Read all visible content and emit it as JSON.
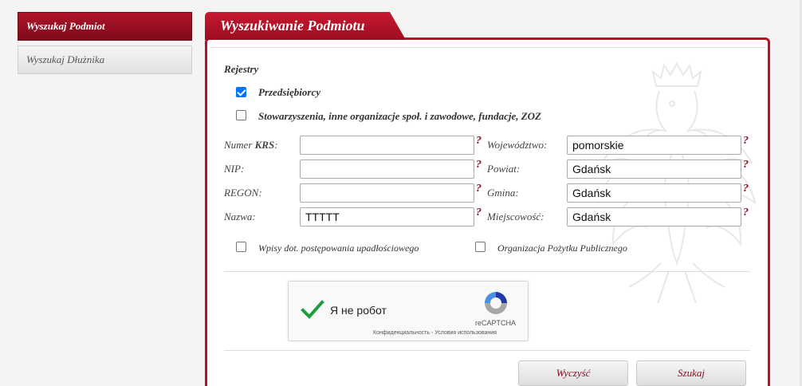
{
  "sidebar": {
    "items": [
      {
        "label": "Wyszukaj Podmiot",
        "active": true
      },
      {
        "label": "Wyszukaj Dłużnika",
        "active": false
      }
    ]
  },
  "panel": {
    "title": "Wyszukiwanie Podmiotu"
  },
  "registers": {
    "heading": "Rejestry",
    "options": [
      {
        "label": "Przedsiębiorcy",
        "checked": true
      },
      {
        "label": "Stowarzyszenia, inne organizacje społ. i zawodowe, fundacje, ZOZ",
        "checked": false
      }
    ]
  },
  "fields": {
    "krs": {
      "label_prefix": "Numer ",
      "label_bold": "KRS",
      "label_suffix": ":",
      "value": ""
    },
    "nip": {
      "label": "NIP:",
      "value": ""
    },
    "regon": {
      "label": "REGON:",
      "value": ""
    },
    "nazwa": {
      "label": "Nazwa:",
      "value": "TTTTT"
    },
    "wojewodztwo": {
      "label": "Województwo:",
      "value": "pomorskie"
    },
    "powiat": {
      "label": "Powiat:",
      "value": "Gdańsk"
    },
    "gmina": {
      "label": "Gmina:",
      "value": "Gdańsk"
    },
    "miejscowosc": {
      "label": "Miejscowość:",
      "value": "Gdańsk"
    },
    "help_glyph": "?"
  },
  "filters": {
    "upadlosc": {
      "label": "Wpisy dot. postępowania upadłościowego",
      "checked": false
    },
    "opp": {
      "label": "Organizacja Pożytku Publicznego",
      "checked": false
    }
  },
  "captcha": {
    "text": "Я не робот",
    "brand": "reCAPTCHA",
    "links": "Конфиденциальность - Условия использования",
    "checked": true
  },
  "buttons": {
    "clear": "Wyczyść",
    "search": "Szukaj"
  },
  "colors": {
    "accent": "#bb1127",
    "accent_dark": "#7e0a1a",
    "help": "#8b0a1e",
    "check_blue": "#0075ff",
    "captcha_green": "#1e9e3e"
  }
}
